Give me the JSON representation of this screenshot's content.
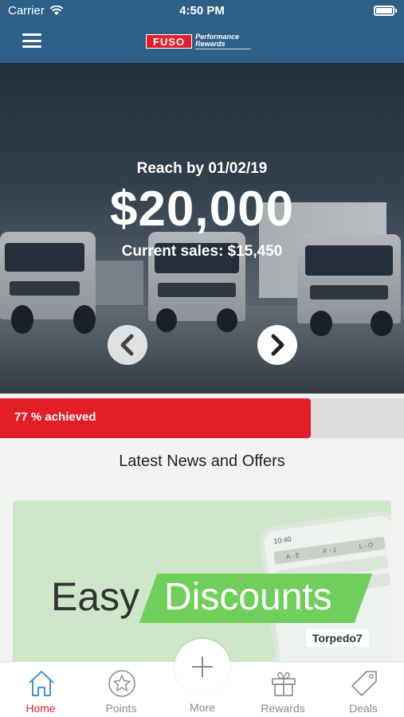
{
  "status_bar": {
    "carrier": "Carrier",
    "time": "4:50 PM"
  },
  "header": {
    "logo_brand": "FUSO",
    "logo_tagline_1": "Performance",
    "logo_tagline_2": "Rewards"
  },
  "hero": {
    "reach_label": "Reach by 01/02/19",
    "goal_amount": "$20,000",
    "current_sales": "Current sales: $15,450"
  },
  "progress": {
    "label": "77 % achieved",
    "percent": 77
  },
  "news": {
    "section_title": "Latest News and Offers",
    "card": {
      "word1": "Easy",
      "word2": "Discounts",
      "brand": "Torpedo7",
      "phone_time": "10:40",
      "phone_tabs": [
        "A - E",
        "F - J",
        "L - O"
      ]
    }
  },
  "tabbar": {
    "tabs": [
      {
        "label": "Home",
        "icon": "home-icon",
        "active": true
      },
      {
        "label": "Points",
        "icon": "star-icon",
        "active": false
      },
      {
        "label": "More",
        "icon": "plus-icon",
        "active": false
      },
      {
        "label": "Rewards",
        "icon": "gift-icon",
        "active": false
      },
      {
        "label": "Deals",
        "icon": "tag-icon",
        "active": false
      }
    ]
  },
  "colors": {
    "header": "#2e5f86",
    "accent": "#e3202a",
    "progress_track": "#dcdcdc"
  }
}
